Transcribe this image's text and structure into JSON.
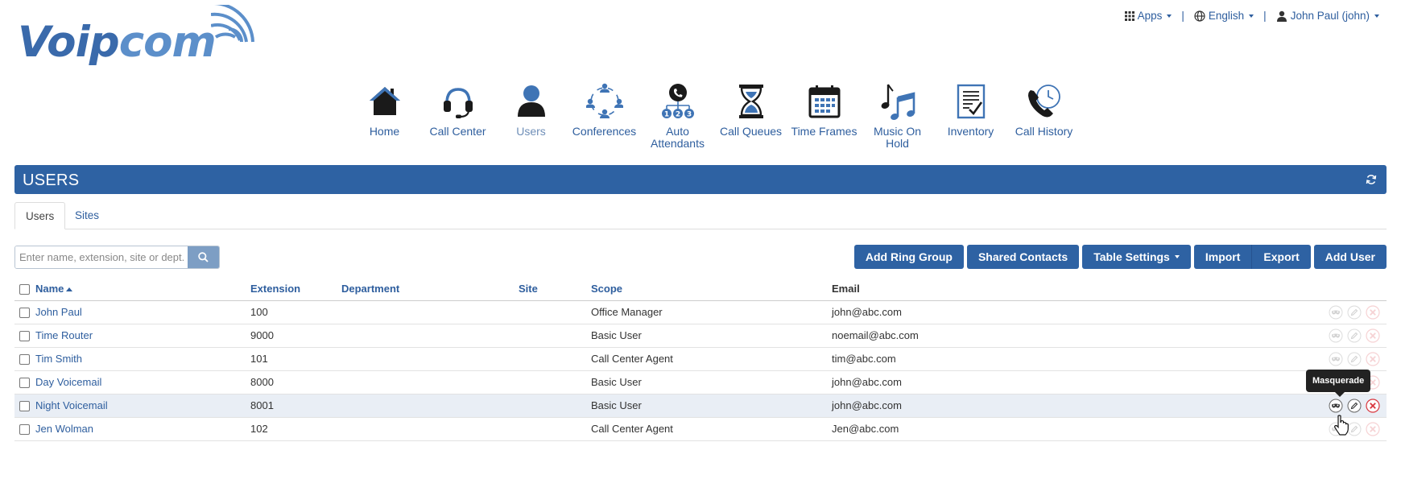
{
  "logo": {
    "text_a": "Voip",
    "text_b": "com"
  },
  "topbar": {
    "apps_label": "Apps",
    "language_label": "English",
    "user_label": "John Paul (john)",
    "separator": "|"
  },
  "nav": [
    {
      "label": "Home",
      "icon": "home-icon"
    },
    {
      "label": "Call Center",
      "icon": "headset-icon"
    },
    {
      "label": "Users",
      "icon": "user-icon",
      "active": true
    },
    {
      "label": "Conferences",
      "icon": "conference-icon"
    },
    {
      "label": "Auto Attendants",
      "icon": "auto-attendant-icon"
    },
    {
      "label": "Call Queues",
      "icon": "hourglass-icon"
    },
    {
      "label": "Time Frames",
      "icon": "calendar-icon"
    },
    {
      "label": "Music On Hold",
      "icon": "music-note-icon"
    },
    {
      "label": "Inventory",
      "icon": "clipboard-check-icon"
    },
    {
      "label": "Call History",
      "icon": "phone-clock-icon"
    }
  ],
  "header": {
    "title": "USERS"
  },
  "tabs": [
    {
      "label": "Users",
      "active": true
    },
    {
      "label": "Sites",
      "active": false
    }
  ],
  "search": {
    "placeholder": "Enter name, extension, site or dept."
  },
  "actions": {
    "add_ring_group": "Add Ring Group",
    "shared_contacts": "Shared Contacts",
    "table_settings": "Table Settings",
    "import": "Import",
    "export": "Export",
    "add_user": "Add User"
  },
  "table": {
    "columns": [
      "Name",
      "Extension",
      "Department",
      "Site",
      "Scope",
      "Email"
    ],
    "rows": [
      {
        "name": "John Paul",
        "extension": "100",
        "department": "",
        "site": "",
        "scope": "Office Manager",
        "email": "john@abc.com"
      },
      {
        "name": "Time Router",
        "extension": "9000",
        "department": "",
        "site": "",
        "scope": "Basic User",
        "email": "noemail@abc.com"
      },
      {
        "name": "Tim Smith",
        "extension": "101",
        "department": "",
        "site": "",
        "scope": "Call Center Agent",
        "email": "tim@abc.com"
      },
      {
        "name": "Day Voicemail",
        "extension": "8000",
        "department": "",
        "site": "",
        "scope": "Basic User",
        "email": "john@abc.com"
      },
      {
        "name": "Night Voicemail",
        "extension": "8001",
        "department": "",
        "site": "",
        "scope": "Basic User",
        "email": "john@abc.com",
        "highlighted": true
      },
      {
        "name": "Jen Wolman",
        "extension": "102",
        "department": "",
        "site": "",
        "scope": "Call Center Agent",
        "email": "Jen@abc.com"
      }
    ]
  },
  "tooltip": {
    "text": "Masquerade"
  },
  "colors": {
    "primary": "#2e62a3",
    "link": "#2e5e9e",
    "delete": "#d9363e",
    "row_highlight": "#e9eef5"
  }
}
